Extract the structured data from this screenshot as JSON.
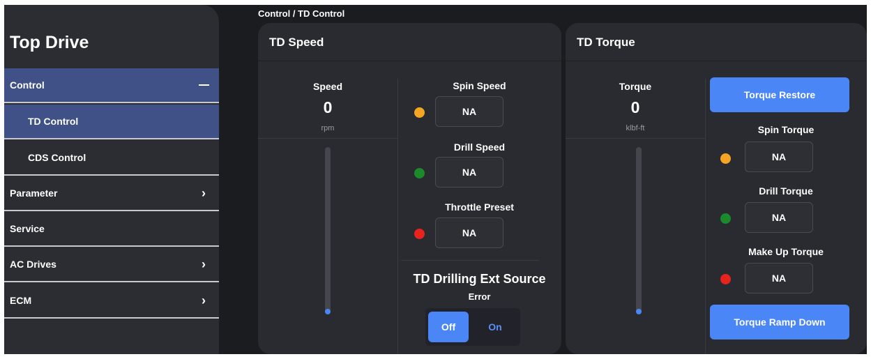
{
  "sidebar": {
    "title": "Top Drive",
    "items": [
      {
        "label": "Control",
        "icon": "minus-icon"
      },
      {
        "label": "TD Control"
      },
      {
        "label": "CDS Control"
      },
      {
        "label": "Parameter",
        "icon": "chevron-right-icon"
      },
      {
        "label": "Service"
      },
      {
        "label": "AC Drives",
        "icon": "chevron-right-icon"
      },
      {
        "label": "ECM",
        "icon": "chevron-right-icon"
      }
    ],
    "chevron": "›"
  },
  "breadcrumb": "Control / TD Control",
  "speed_panel": {
    "title": "TD Speed",
    "metric": {
      "label": "Speed",
      "value": "0",
      "unit": "rpm"
    },
    "slider_level": 0,
    "fields": [
      {
        "label": "Spin Speed",
        "value": "NA",
        "dot_color": "#f5a524"
      },
      {
        "label": "Drill Speed",
        "value": "NA",
        "dot_color": "#1a8a2a"
      },
      {
        "label": "Throttle Preset",
        "value": "NA",
        "dot_color": "#e8231d"
      }
    ],
    "ext_source": {
      "title": "TD Drilling Ext Source",
      "status": "Error",
      "off_label": "Off",
      "on_label": "On",
      "selected": "Off"
    }
  },
  "torque_panel": {
    "title": "TD Torque",
    "metric": {
      "label": "Torque",
      "value": "0",
      "unit": "klbf-ft"
    },
    "slider_level": 0,
    "restore_button": "Torque Restore",
    "fields": [
      {
        "label": "Spin Torque",
        "value": "NA",
        "dot_color": "#f5a524"
      },
      {
        "label": "Drill Torque",
        "value": "NA",
        "dot_color": "#1a8a2a"
      },
      {
        "label": "Make Up Torque",
        "value": "NA",
        "dot_color": "#e8231d"
      }
    ],
    "ramp_button": "Torque Ramp Down"
  },
  "colors": {
    "accent": "#4a86f5",
    "active_nav": "#3f5187"
  }
}
